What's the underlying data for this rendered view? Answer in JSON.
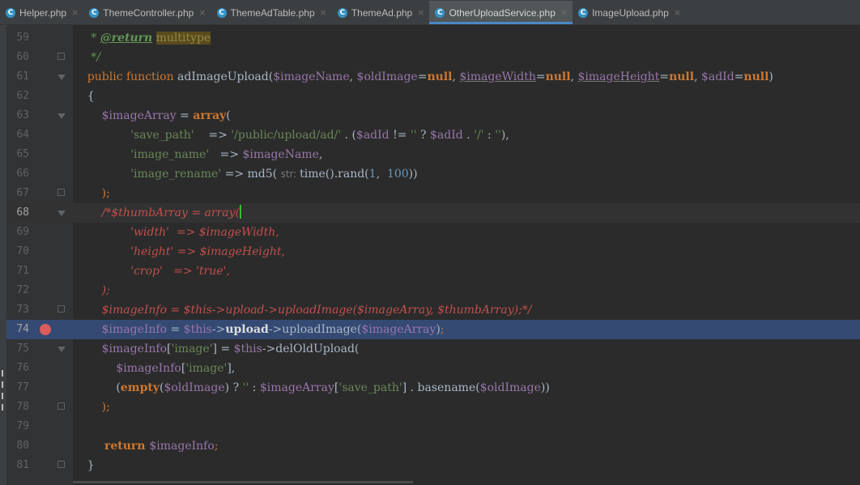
{
  "tabs": [
    {
      "label": "Helper.php",
      "icon": "C",
      "active": false
    },
    {
      "label": "ThemeController.php",
      "icon": "C",
      "active": false
    },
    {
      "label": "ThemeAdTable.php",
      "icon": "C",
      "active": false
    },
    {
      "label": "ThemeAd.php",
      "icon": "C",
      "active": false
    },
    {
      "label": "OtherUploadService.php",
      "icon": "C",
      "active": true
    },
    {
      "label": "ImageUpload.php",
      "icon": "C",
      "active": false
    }
  ],
  "tab_close_glyph": "×",
  "editor": {
    "caret_line": 68,
    "breakpoint_line": 74,
    "lines": [
      {
        "n": "59",
        "fold": "",
        "segs": [
          [
            "t-com",
            "     * "
          ],
          [
            "t-tag",
            "@return"
          ],
          [
            "t-com",
            " "
          ],
          [
            "t-doc-hl",
            "multitype"
          ]
        ]
      },
      {
        "n": "60",
        "fold": "end",
        "segs": [
          [
            "t-com",
            "     */"
          ]
        ]
      },
      {
        "n": "61",
        "fold": "arrow",
        "segs": [
          [
            "t-kw",
            "    public function "
          ],
          [
            "",
            "adImageUpload("
          ],
          [
            "t-var",
            "$imageName"
          ],
          [
            "",
            ", "
          ],
          [
            "t-var",
            "$oldImage"
          ],
          [
            "",
            "="
          ],
          [
            "t-kw t-bold",
            "null"
          ],
          [
            "",
            ", "
          ],
          [
            "t-under",
            "$imageWidth"
          ],
          [
            "",
            "="
          ],
          [
            "t-kw t-bold",
            "null"
          ],
          [
            "",
            ", "
          ],
          [
            "t-under",
            "$imageHeight"
          ],
          [
            "",
            "="
          ],
          [
            "t-kw t-bold",
            "null"
          ],
          [
            "",
            ", "
          ],
          [
            "t-var",
            "$adId"
          ],
          [
            "",
            "="
          ],
          [
            "t-kw t-bold",
            "null"
          ],
          [
            "",
            ")"
          ]
        ]
      },
      {
        "n": "62",
        "fold": "",
        "segs": [
          [
            "",
            "    {"
          ]
        ]
      },
      {
        "n": "63",
        "fold": "arrow",
        "segs": [
          [
            "t-var",
            "        $imageArray"
          ],
          [
            "",
            " = "
          ],
          [
            "t-kw t-bold",
            "array"
          ],
          [
            "",
            "("
          ]
        ]
      },
      {
        "n": "64",
        "fold": "",
        "segs": [
          [
            "t-str",
            "                'save_path'"
          ],
          [
            "",
            "    => "
          ],
          [
            "t-str",
            "'/public/upload/ad/'"
          ],
          [
            "",
            " . ("
          ],
          [
            "t-var",
            "$adId"
          ],
          [
            "",
            " != "
          ],
          [
            "t-str",
            "''"
          ],
          [
            "",
            " ? "
          ],
          [
            "t-var",
            "$adId"
          ],
          [
            "",
            " . "
          ],
          [
            "t-str",
            "'/'"
          ],
          [
            "",
            " : "
          ],
          [
            "t-str",
            "''"
          ],
          [
            "",
            "),"
          ]
        ]
      },
      {
        "n": "65",
        "fold": "",
        "segs": [
          [
            "t-str",
            "                'image_name'"
          ],
          [
            "",
            "   => "
          ],
          [
            "t-var",
            "$imageName"
          ],
          [
            "",
            ","
          ]
        ]
      },
      {
        "n": "66",
        "fold": "",
        "segs": [
          [
            "t-str",
            "                'image_rename'"
          ],
          [
            "",
            " => md5( "
          ],
          [
            "t-hint",
            "str: "
          ],
          [
            "",
            "time().rand("
          ],
          [
            "t-num",
            "1"
          ],
          [
            "",
            ",  "
          ],
          [
            "t-num",
            "100"
          ],
          [
            "",
            "))"
          ]
        ]
      },
      {
        "n": "67",
        "fold": "end",
        "segs": [
          [
            "t-kw",
            "        );"
          ]
        ]
      },
      {
        "n": "68",
        "fold": "arrow",
        "segs": [
          [
            "t-deprecated-com",
            "        /*$thumbArray = array("
          ],
          [
            "caret",
            ""
          ]
        ]
      },
      {
        "n": "69",
        "fold": "",
        "segs": [
          [
            "t-deprecated-com",
            "                'width'  => $imageWidth,"
          ]
        ]
      },
      {
        "n": "70",
        "fold": "",
        "segs": [
          [
            "t-deprecated-com",
            "                'height' => $imageHeight,"
          ]
        ]
      },
      {
        "n": "71",
        "fold": "",
        "segs": [
          [
            "t-deprecated-com",
            "                'crop'   => 'true',"
          ]
        ]
      },
      {
        "n": "72",
        "fold": "",
        "segs": [
          [
            "t-deprecated-com",
            "        );"
          ]
        ]
      },
      {
        "n": "73",
        "fold": "end",
        "segs": [
          [
            "t-deprecated-com",
            "        $imageInfo = $this->upload->uploadImage($imageArray, $thumbArray);*/"
          ]
        ]
      },
      {
        "n": "74",
        "fold": "",
        "segs": [
          [
            "t-var",
            "        $imageInfo"
          ],
          [
            "",
            " = "
          ],
          [
            "t-var",
            "$this"
          ],
          [
            "",
            "->"
          ],
          [
            "t-prop",
            "upload"
          ],
          [
            "",
            "->uploadImage("
          ],
          [
            "t-var",
            "$imageArray"
          ],
          [
            "",
            ")"
          ],
          [
            "t-kw",
            ";"
          ]
        ]
      },
      {
        "n": "75",
        "fold": "arrow",
        "segs": [
          [
            "t-var",
            "        $imageInfo"
          ],
          [
            "",
            "["
          ],
          [
            "t-str",
            "'image'"
          ],
          [
            "",
            "] = "
          ],
          [
            "t-var",
            "$this"
          ],
          [
            "",
            "->delOldUpload("
          ]
        ]
      },
      {
        "n": "76",
        "fold": "",
        "segs": [
          [
            "t-var",
            "            $imageInfo"
          ],
          [
            "",
            "["
          ],
          [
            "t-str",
            "'image'"
          ],
          [
            "",
            "],"
          ]
        ]
      },
      {
        "n": "77",
        "fold": "",
        "segs": [
          [
            "",
            "            ("
          ],
          [
            "t-kw t-bold",
            "empty"
          ],
          [
            "",
            "("
          ],
          [
            "t-var",
            "$oldImage"
          ],
          [
            "",
            ") ? "
          ],
          [
            "t-str",
            "''"
          ],
          [
            "",
            " : "
          ],
          [
            "t-var",
            "$imageArray"
          ],
          [
            "",
            "["
          ],
          [
            "t-str",
            "'save_path'"
          ],
          [
            "",
            "] . basename("
          ],
          [
            "t-var",
            "$oldImage"
          ],
          [
            "",
            "))"
          ]
        ]
      },
      {
        "n": "78",
        "fold": "end",
        "segs": [
          [
            "t-kw",
            "        );"
          ]
        ]
      },
      {
        "n": "79",
        "fold": "",
        "segs": [
          [
            "",
            ""
          ]
        ]
      },
      {
        "n": "80",
        "fold": "",
        "segs": [
          [
            "t-kw t-bold",
            "        return "
          ],
          [
            "t-var",
            "$imageInfo"
          ],
          [
            "t-kw",
            ";"
          ]
        ]
      },
      {
        "n": "81",
        "fold": "end",
        "segs": [
          [
            "",
            "    }"
          ]
        ]
      }
    ]
  }
}
